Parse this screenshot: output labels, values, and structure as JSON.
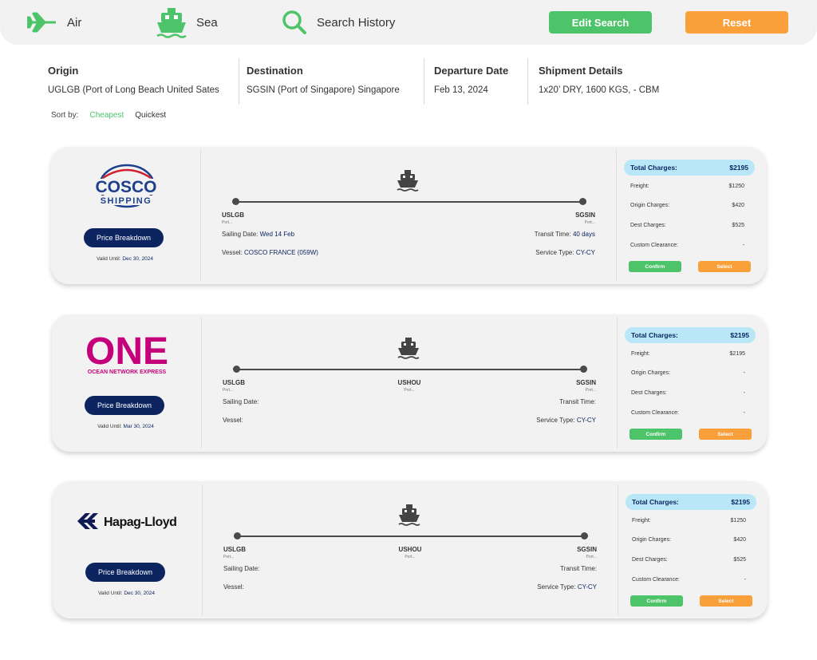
{
  "nav": {
    "air_label": "Air",
    "sea_label": "Sea",
    "history_label": "Search History",
    "edit_label": "Edit Search",
    "reset_label": "Reset"
  },
  "summary": {
    "origin_label": "Origin",
    "origin_value": "UGLGB (Port of Long Beach United Sates",
    "destination_label": "Destination",
    "destination_value": "SGSIN (Port of Singapore) Singapore",
    "departure_label": "Departure Date",
    "departure_value": "Feb 13, 2024",
    "shipment_label": "Shipment Details",
    "shipment_value": "1x20’ DRY, 1600 KGS, - CBM"
  },
  "sort": {
    "label": "Sort by:",
    "cheapest": "Cheapest",
    "quickest": "Quickest"
  },
  "colors": {
    "green": "#4ec46a",
    "orange": "#f9a03a",
    "navy": "#0c2561",
    "light_blue": "#b9e7f7",
    "cosco_blue": "#1d3f8c",
    "cosco_red": "#d0202f",
    "one_magenta": "#c4007a",
    "hapag_navy": "#0e1a54"
  },
  "cards": [
    {
      "carrier": "cosco",
      "logo": {
        "top": "COSCO",
        "bottom": "SHIPPING"
      },
      "price_breakdown": "Price Breakdown",
      "valid_label": "Valid Until:",
      "valid_date": "Dec 30, 2024",
      "origin_port": "USLGB",
      "origin_sub": "Port...",
      "dest_port": "SGSIN",
      "dest_sub": "Port...",
      "sailing_label": "Sailing Date:",
      "sailing_value": "Wed 14 Feb",
      "transit_label": "Transit Time:",
      "transit_value": "40 days",
      "vessel_label": "Vessel:",
      "vessel_value": "COSCO FRANCE (059W)",
      "service_label": "Service Type:",
      "service_value": "CY-CY",
      "total_label": "Total Charges:",
      "total_value": "$2195",
      "charges": [
        {
          "label": "Freight:",
          "value": "$1250"
        },
        {
          "label": "Origin Charges:",
          "value": "$420"
        },
        {
          "label": "Dest Charges:",
          "value": "$525"
        },
        {
          "label": "Custom Clearance:",
          "value": "-"
        }
      ],
      "confirm_label": "Confirm",
      "select_label": "Select"
    },
    {
      "carrier": "one",
      "logo": {
        "top": "ONE",
        "bottom": "OCEAN NETWORK EXPRESS"
      },
      "price_breakdown": "Price Breakdown",
      "valid_label": "Valid Until:",
      "valid_date": "Mar 30, 2024",
      "origin_port": "USLGB",
      "origin_sub": "Port...",
      "mid_port": "USHOU",
      "mid_sub": "Port...",
      "dest_port": "SGSIN",
      "dest_sub": "Port...",
      "sailing_label": "Sailing Date:",
      "sailing_value": "",
      "transit_label": "Transit Time:",
      "transit_value": "",
      "vessel_label": "Vessel:",
      "vessel_value": "",
      "service_label": "Service Type:",
      "service_value": "CY-CY",
      "total_label": "Total Charges:",
      "total_value": "$2195",
      "charges": [
        {
          "label": "Freight:",
          "value": "$2195"
        },
        {
          "label": "Origin Charges:",
          "value": "-"
        },
        {
          "label": "Dest Charges:",
          "value": "-"
        },
        {
          "label": "Custom Clearance:",
          "value": "-"
        }
      ],
      "confirm_label": "Confirm",
      "select_label": "Select"
    },
    {
      "carrier": "hapag",
      "logo": {
        "top": "Hapag-Lloyd",
        "bottom": ""
      },
      "price_breakdown": "Price Breakdown",
      "valid_label": "Valid Until:",
      "valid_date": "Dec 30, 2024",
      "origin_port": "USLGB",
      "origin_sub": "Port...",
      "mid_port": "USHOU",
      "mid_sub": "Port...",
      "dest_port": "SGSIN",
      "dest_sub": "Port...",
      "sailing_label": "Sailing Date:",
      "sailing_value": "",
      "transit_label": "Transit Time:",
      "transit_value": "",
      "vessel_label": "Vessel:",
      "vessel_value": "",
      "service_label": "Service Type:",
      "service_value": "CY-CY",
      "total_label": "Total Charges:",
      "total_value": "$2195",
      "charges": [
        {
          "label": "Freight:",
          "value": "$1250"
        },
        {
          "label": "Origin Charges:",
          "value": "$420"
        },
        {
          "label": "Dest Charges:",
          "value": "$525"
        },
        {
          "label": "Custom Clearance:",
          "value": "-"
        }
      ],
      "confirm_label": "Confirm",
      "select_label": "Select"
    }
  ]
}
